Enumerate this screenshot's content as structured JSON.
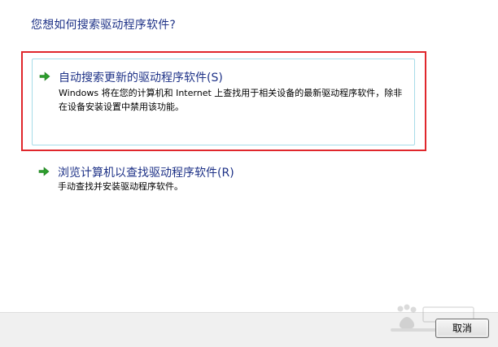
{
  "dialog": {
    "question": "您想如何搜索驱动程序软件?"
  },
  "options": [
    {
      "title": "自动搜索更新的驱动程序软件(S)",
      "description": "Windows 将在您的计算机和 Internet 上查找用于相关设备的最新驱动程序软件，除非在设备安装设置中禁用该功能。",
      "icon": "green-arrow-icon",
      "selected": true
    },
    {
      "title": "浏览计算机以查找驱动程序软件(R)",
      "description": "手动查找并安装驱动程序软件。",
      "icon": "green-arrow-icon",
      "selected": false
    }
  ],
  "footer": {
    "cancel_label": "取消"
  },
  "colors": {
    "title_blue": "#1e3287",
    "highlight_red": "#e0272c",
    "arrow_green": "#2c9e2c",
    "selection_border": "#a7dce9"
  }
}
